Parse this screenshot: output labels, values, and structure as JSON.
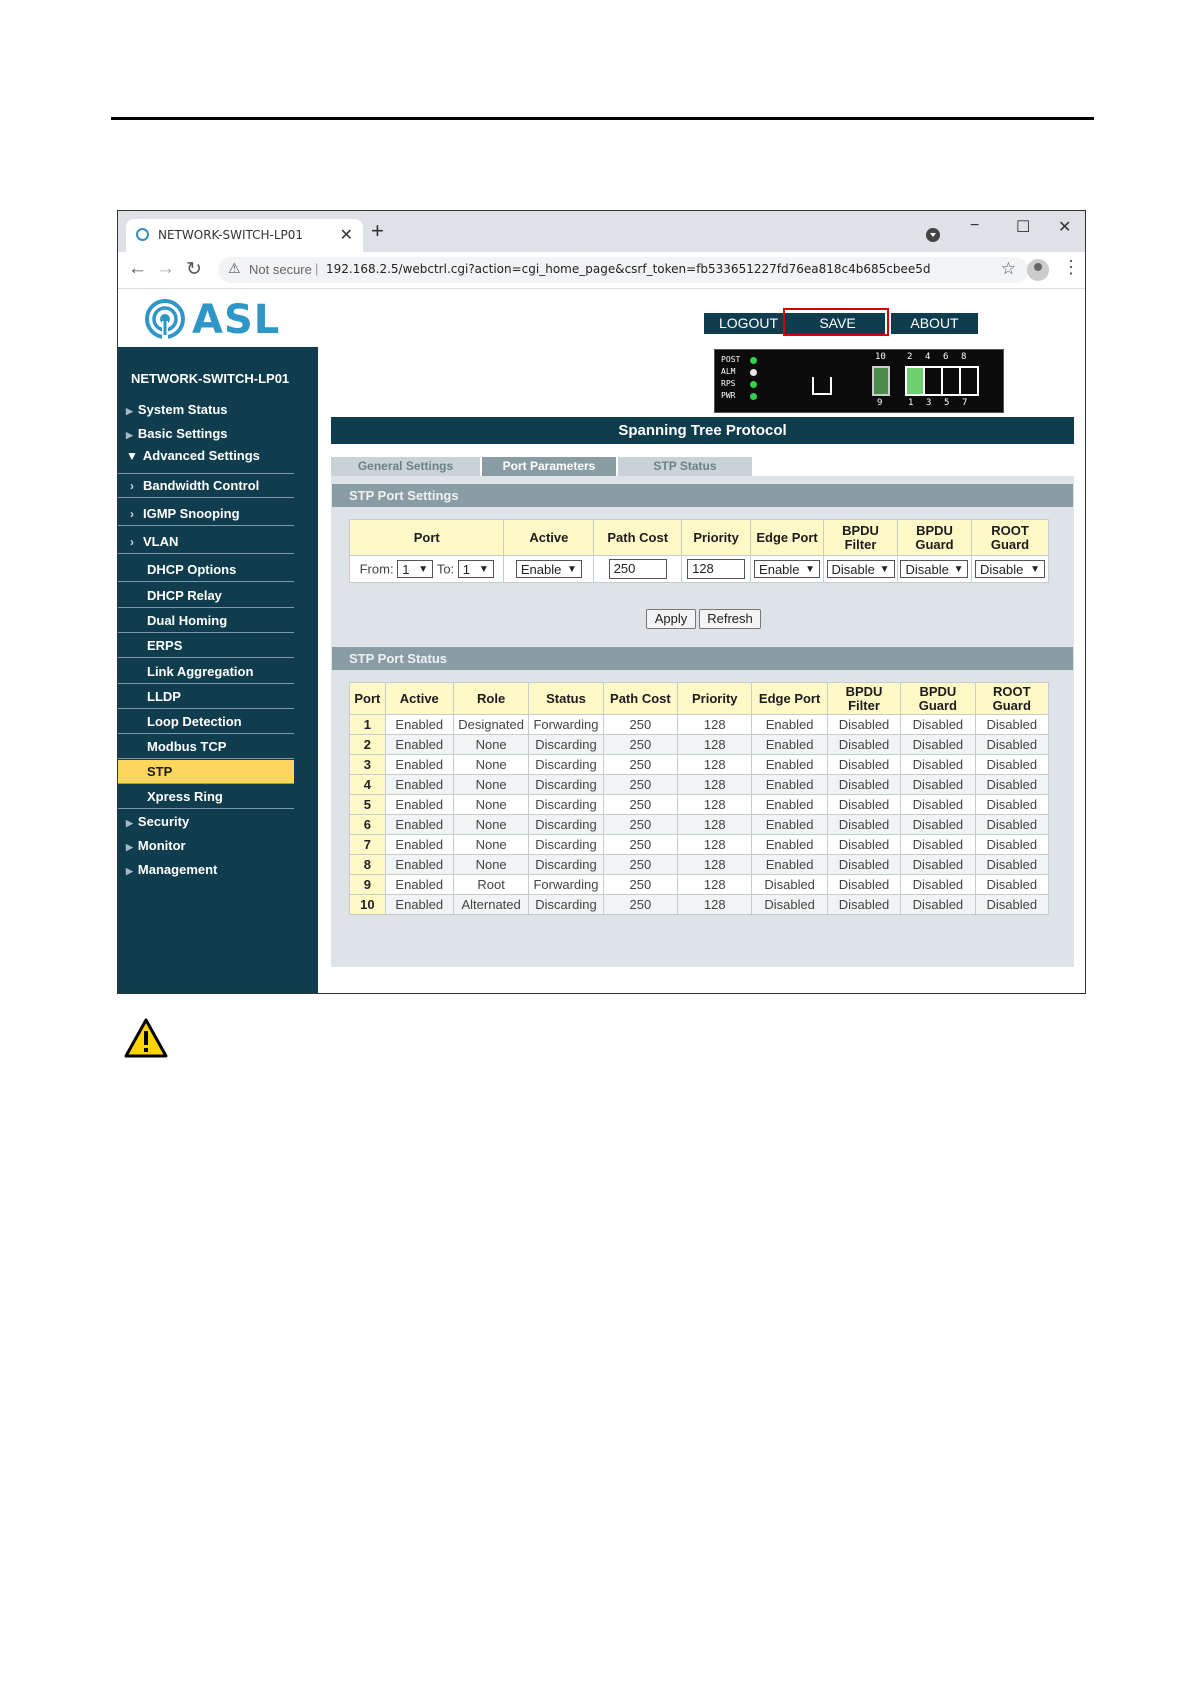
{
  "browser": {
    "tab_title": "NETWORK-SWITCH-LP01",
    "security_label": "Not secure",
    "url": "192.168.2.5/webctrl.cgi?action=cgi_home_page&csrf_token=fb533651227fd76ea818c4b685cbee5d"
  },
  "brand": {
    "logo_text": "ASL",
    "device_name": "NETWORK-SWITCH-LP01"
  },
  "header_buttons": {
    "logout": "LOGOUT",
    "save": "SAVE",
    "about": "ABOUT"
  },
  "front_panel": {
    "leds": [
      "POST",
      "ALM",
      "RPS",
      "PWR"
    ],
    "top_ports": [
      "10",
      "2",
      "4",
      "6",
      "8"
    ],
    "bottom_ports": [
      "9",
      "1",
      "3",
      "5",
      "7"
    ]
  },
  "sidebar": {
    "top_items": {
      "system_status": "System Status",
      "basic_settings": "Basic Settings",
      "advanced_settings": "Advanced Settings",
      "security": "Security",
      "monitor": "Monitor",
      "management": "Management"
    },
    "advanced_items": [
      "Bandwidth Control",
      "IGMP Snooping",
      "VLAN",
      "DHCP Options",
      "DHCP Relay",
      "Dual Homing",
      "ERPS",
      "Link Aggregation",
      "LLDP",
      "Loop Detection",
      "Modbus TCP",
      "STP",
      "Xpress Ring"
    ],
    "active_item": "STP"
  },
  "page_title": "Spanning Tree Protocol",
  "tabs": [
    "General Settings",
    "Port Parameters",
    "STP Status"
  ],
  "active_tab": "Port Parameters",
  "settings": {
    "section_title": "STP Port Settings",
    "headers": {
      "port": "Port",
      "active": "Active",
      "path_cost": "Path Cost",
      "priority": "Priority",
      "edge_port": "Edge Port",
      "bpdu_filter_1": "BPDU",
      "bpdu_filter_2": "Filter",
      "bpdu_guard_1": "BPDU",
      "bpdu_guard_2": "Guard",
      "root_guard_1": "ROOT",
      "root_guard_2": "Guard"
    },
    "from_label": "From:",
    "from_value": "1",
    "to_label": "To:",
    "to_value": "1",
    "active_value": "Enable",
    "path_cost_value": "250",
    "priority_value": "128",
    "edge_port_value": "Enable",
    "bpdu_filter_value": "Disable",
    "bpdu_guard_value": "Disable",
    "root_guard_value": "Disable",
    "apply_label": "Apply",
    "refresh_label": "Refresh"
  },
  "status": {
    "section_title": "STP Port Status",
    "headers": {
      "port": "Port",
      "active": "Active",
      "role": "Role",
      "status": "Status",
      "path_cost": "Path Cost",
      "priority": "Priority",
      "edge_port": "Edge Port",
      "bpdu_filter_1": "BPDU",
      "bpdu_filter_2": "Filter",
      "bpdu_guard_1": "BPDU",
      "bpdu_guard_2": "Guard",
      "root_guard_1": "ROOT",
      "root_guard_2": "Guard"
    },
    "rows": [
      [
        "1",
        "Enabled",
        "Designated",
        "Forwarding",
        "250",
        "128",
        "Enabled",
        "Disabled",
        "Disabled",
        "Disabled"
      ],
      [
        "2",
        "Enabled",
        "None",
        "Discarding",
        "250",
        "128",
        "Enabled",
        "Disabled",
        "Disabled",
        "Disabled"
      ],
      [
        "3",
        "Enabled",
        "None",
        "Discarding",
        "250",
        "128",
        "Enabled",
        "Disabled",
        "Disabled",
        "Disabled"
      ],
      [
        "4",
        "Enabled",
        "None",
        "Discarding",
        "250",
        "128",
        "Enabled",
        "Disabled",
        "Disabled",
        "Disabled"
      ],
      [
        "5",
        "Enabled",
        "None",
        "Discarding",
        "250",
        "128",
        "Enabled",
        "Disabled",
        "Disabled",
        "Disabled"
      ],
      [
        "6",
        "Enabled",
        "None",
        "Discarding",
        "250",
        "128",
        "Enabled",
        "Disabled",
        "Disabled",
        "Disabled"
      ],
      [
        "7",
        "Enabled",
        "None",
        "Discarding",
        "250",
        "128",
        "Enabled",
        "Disabled",
        "Disabled",
        "Disabled"
      ],
      [
        "8",
        "Enabled",
        "None",
        "Discarding",
        "250",
        "128",
        "Enabled",
        "Disabled",
        "Disabled",
        "Disabled"
      ],
      [
        "9",
        "Enabled",
        "Root",
        "Forwarding",
        "250",
        "128",
        "Disabled",
        "Disabled",
        "Disabled",
        "Disabled"
      ],
      [
        "10",
        "Enabled",
        "Alternated",
        "Discarding",
        "250",
        "128",
        "Disabled",
        "Disabled",
        "Disabled",
        "Disabled"
      ]
    ]
  },
  "colors": {
    "navy": "#103d4d",
    "active_menu": "#ffd55a",
    "header_cell": "#fff9c8",
    "section_bar": "#8a9ca4",
    "highlight": "#d90000"
  }
}
